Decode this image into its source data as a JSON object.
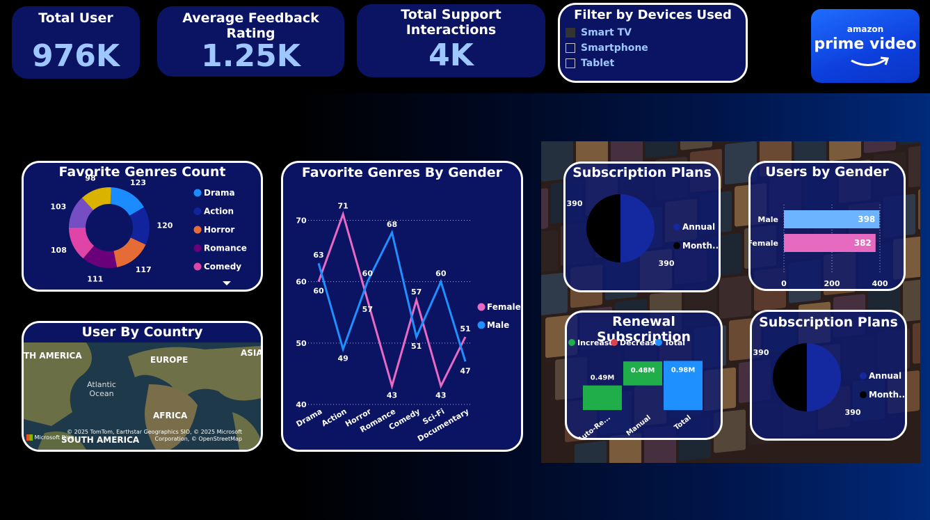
{
  "kpis": {
    "total_user": {
      "title": "Total User",
      "value": "976K"
    },
    "avg_feedback": {
      "title": "Average Feedback Rating",
      "value": "1.25K"
    },
    "support": {
      "title": "Total Support Interactions",
      "value": "4K"
    }
  },
  "filter": {
    "title": "Filter by Devices Used",
    "options": [
      {
        "label": "Smart TV",
        "checked": true
      },
      {
        "label": "Smartphone",
        "checked": false
      },
      {
        "label": "Tablet",
        "checked": false
      }
    ]
  },
  "logo": {
    "top": "amazon",
    "bottom": "prime video"
  },
  "genres_count": {
    "title": "Favorite Genres Count",
    "legend": [
      "Drama",
      "Action",
      "Horror",
      "Romance",
      "Comedy"
    ],
    "chart_data": {
      "type": "pie",
      "donut": true,
      "categories": [
        "Drama",
        "Action",
        "Horror",
        "Romance",
        "Comedy",
        "",
        "",
        ""
      ],
      "values": [
        123,
        120,
        117,
        111,
        108,
        103,
        98
      ],
      "colors": [
        "#1a8cff",
        "#12239e",
        "#e66c37",
        "#6b007b",
        "#e044a7",
        "#744ec2",
        "#d9b300"
      ]
    }
  },
  "country_map": {
    "title": "User By Country",
    "labels": [
      "TH AMERICA",
      "EUROPE",
      "ASIA",
      "Atlantic\nOcean",
      "AFRICA",
      "SOUTH AMERICA"
    ],
    "credit": "© 2025 TomTom, Earthstar Geographics SIO, © 2025 Microsoft Corporation, © OpenStreetMap",
    "brand": "Microsoft Bing"
  },
  "genres_gender": {
    "title": "Favorite Genres By Gender",
    "chart_data": {
      "type": "line",
      "categories": [
        "Drama",
        "Action",
        "Horror",
        "Romance",
        "Comedy",
        "Sci-Fi",
        "Documentary"
      ],
      "series": [
        {
          "name": "Female",
          "values": [
            60,
            71,
            57,
            43,
            57,
            43,
            51
          ],
          "color": "#e86ac4"
        },
        {
          "name": "Male",
          "values": [
            63,
            49,
            60,
            68,
            51,
            60,
            47
          ],
          "color": "#1e90ff"
        }
      ],
      "ylim": [
        40,
        72
      ],
      "yticks": [
        40,
        50,
        60,
        70
      ]
    }
  },
  "subscription_plans_1": {
    "title": "Subscription Plans",
    "legend": [
      "Annual",
      "Month..."
    ],
    "chart_data": {
      "type": "pie",
      "categories": [
        "Annual",
        "Monthly"
      ],
      "values": [
        390,
        390
      ],
      "colors": [
        "#1428a0",
        "#000000"
      ]
    }
  },
  "users_gender": {
    "title": "Users by Gender",
    "chart_data": {
      "type": "bar",
      "orientation": "horizontal",
      "categories": [
        "Male",
        "Female"
      ],
      "values": [
        398,
        382
      ],
      "colors": [
        "#6cb4ff",
        "#e66ac0"
      ],
      "xlim": [
        0,
        400
      ],
      "xticks": [
        0,
        200,
        400
      ]
    }
  },
  "renewal": {
    "title": "Renewal Subscription",
    "legend": [
      {
        "label": "Increase",
        "color": "#1fae4a"
      },
      {
        "label": "Decrease",
        "color": "#e0404a"
      },
      {
        "label": "Total",
        "color": "#1e90ff"
      }
    ],
    "chart_data": {
      "type": "bar",
      "subtype": "waterfall",
      "categories": [
        "Auto-Re...",
        "Manual",
        "Total"
      ],
      "values": [
        0.49,
        0.48,
        0.98
      ],
      "labels": [
        "0.49M",
        "0.48M",
        "0.98M"
      ],
      "kinds": [
        "increase",
        "increase",
        "total"
      ],
      "ylim": [
        0,
        1.0
      ]
    }
  },
  "subscription_plans_2": {
    "title": "Subscription Plans",
    "legend": [
      "Annual",
      "Month..."
    ],
    "chart_data": {
      "type": "pie",
      "categories": [
        "Annual",
        "Monthly"
      ],
      "values": [
        390,
        390
      ],
      "colors": [
        "#1428a0",
        "#000000"
      ]
    }
  }
}
